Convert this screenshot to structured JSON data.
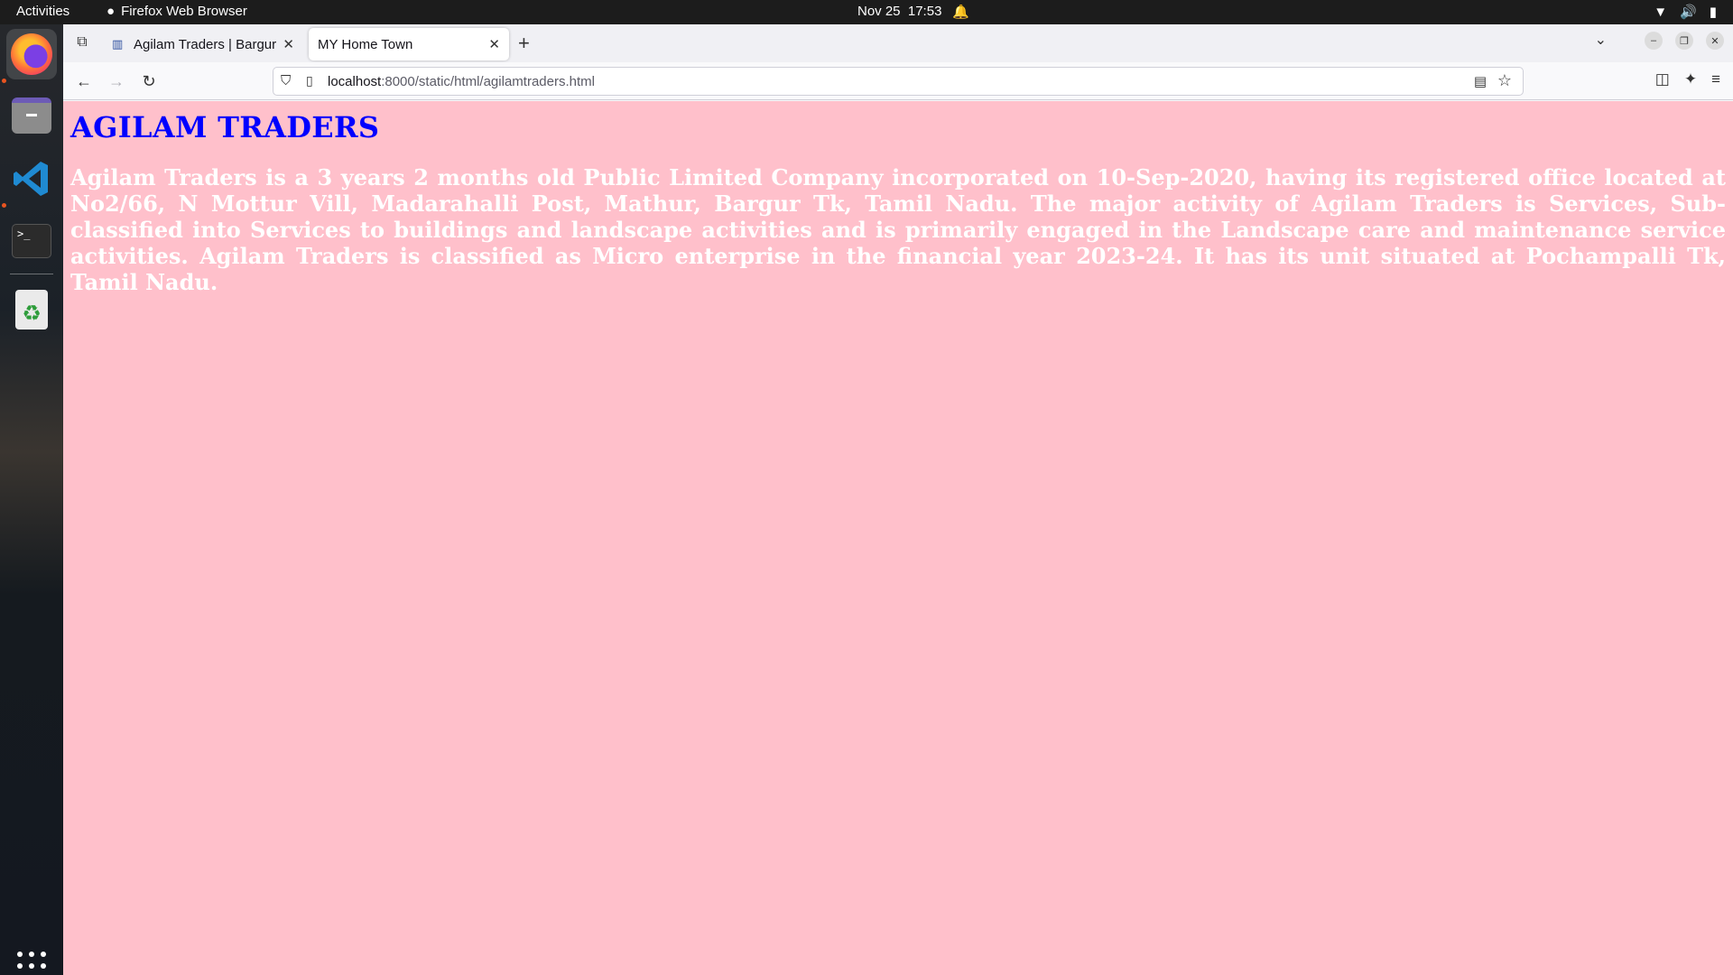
{
  "topbar": {
    "activities": "Activities",
    "app_name": "Firefox Web Browser",
    "date": "Nov 25",
    "time": "17:53"
  },
  "dock": {
    "items": [
      "Firefox",
      "Files",
      "Visual Studio Code",
      "Terminal",
      "Trash"
    ]
  },
  "browser": {
    "tabs": [
      {
        "title": "Agilam Traders | Bargur T",
        "active": false
      },
      {
        "title": "MY Home Town",
        "active": true
      }
    ],
    "url_host": "localhost",
    "url_rest": ":8000/static/html/agilamtraders.html"
  },
  "page": {
    "heading": "AGILAM TRADERS",
    "body": "Agilam Traders is a 3 years 2 months old Public Limited Company incorporated on 10-Sep-2020, having its registered office located at No2/66, N Mottur Vill, Madarahalli Post, Mathur, Bargur Tk, Tamil Nadu. The major activity of Agilam Traders is Services, Sub-classified into Services to buildings and landscape activities and is primarily engaged in the Landscape care and maintenance service activities. Agilam Traders is classified as Micro enterprise in the financial year 2023-24. It has its unit situated at Pochampalli Tk, Tamil Nadu.",
    "background_color": "#ffc0cb",
    "heading_color": "#0000ff",
    "body_color": "#ffffff"
  }
}
